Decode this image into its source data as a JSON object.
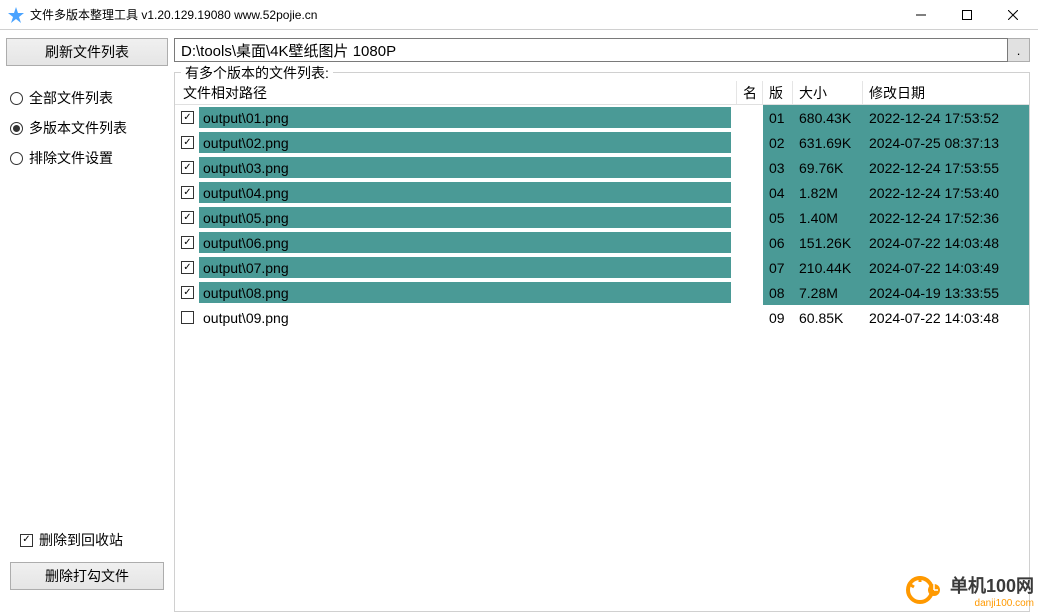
{
  "window": {
    "title": "文件多版本整理工具 v1.20.129.19080 www.52pojie.cn"
  },
  "sidebar": {
    "refresh_btn": "刷新文件列表",
    "radios": [
      {
        "label": "全部文件列表",
        "checked": false
      },
      {
        "label": "多版本文件列表",
        "checked": true
      },
      {
        "label": "排除文件设置",
        "checked": false
      }
    ],
    "recycle_chk": "删除到回收站",
    "delete_btn": "删除打勾文件"
  },
  "main": {
    "path": "D:\\tools\\桌面\\4K壁纸图片 1080P",
    "browse": ".",
    "group_label": "有多个版本的文件列表:",
    "headers": {
      "path": "文件相对路径",
      "name": "名",
      "ver": "版",
      "size": "大小",
      "date": "修改日期"
    },
    "rows": [
      {
        "checked": true,
        "hl": true,
        "path": "output\\01.png",
        "ver": "01",
        "size": "680.43K",
        "date": "2022-12-24 17:53:52"
      },
      {
        "checked": true,
        "hl": true,
        "path": "output\\02.png",
        "ver": "02",
        "size": "631.69K",
        "date": "2024-07-25 08:37:13"
      },
      {
        "checked": true,
        "hl": true,
        "path": "output\\03.png",
        "ver": "03",
        "size": "69.76K",
        "date": "2022-12-24 17:53:55"
      },
      {
        "checked": true,
        "hl": true,
        "path": "output\\04.png",
        "ver": "04",
        "size": "1.82M",
        "date": "2022-12-24 17:53:40"
      },
      {
        "checked": true,
        "hl": true,
        "path": "output\\05.png",
        "ver": "05",
        "size": "1.40M",
        "date": "2022-12-24 17:52:36"
      },
      {
        "checked": true,
        "hl": true,
        "path": "output\\06.png",
        "ver": "06",
        "size": "151.26K",
        "date": "2024-07-22 14:03:48"
      },
      {
        "checked": true,
        "hl": true,
        "path": "output\\07.png",
        "ver": "07",
        "size": "210.44K",
        "date": "2024-07-22 14:03:49"
      },
      {
        "checked": true,
        "hl": true,
        "path": "output\\08.png",
        "ver": "08",
        "size": "7.28M",
        "date": "2024-04-19 13:33:55"
      },
      {
        "checked": false,
        "hl": false,
        "path": "output\\09.png",
        "ver": "09",
        "size": "60.85K",
        "date": "2024-07-22 14:03:48"
      }
    ]
  },
  "watermark": {
    "name": "单机100网",
    "url": "danji100.com"
  }
}
